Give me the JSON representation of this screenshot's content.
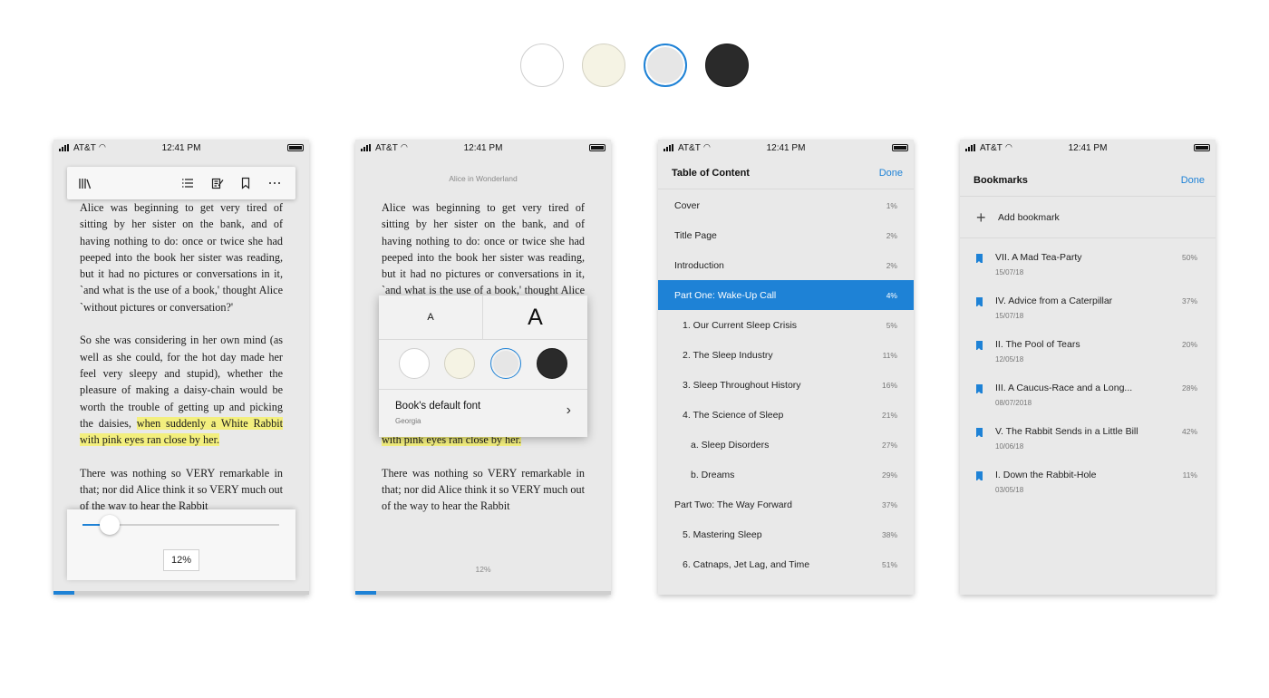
{
  "status_bar": {
    "carrier": "AT&T",
    "time": "12:41 PM"
  },
  "colors": {
    "accent": "#1e82d6",
    "highlight": "#f3ef7e",
    "theme_white": "#ffffff",
    "theme_sepia": "#f5f3e4",
    "theme_gray": "#e6e6e6",
    "theme_dark": "#2a2a2a"
  },
  "icons": {
    "library": "library-icon",
    "contents": "list-icon",
    "notes": "notes-icon",
    "bookmark": "bookmark-icon",
    "more": "more-icon",
    "chevron": "chevron-right-icon",
    "add": "plus-icon"
  },
  "book": {
    "title": "Alice in Wonderland",
    "paragraph_1": "Alice was beginning to get very tired of sitting by her sister on the bank, and of having nothing to do: once or twice she had peeped into the book her sister was reading, but it had no pictures or conversations in it, `and what is the use of a book,' thought Alice `without pictures or conversation?'",
    "paragraph_2_plain": "So she was considering in her own mind (as well as she could, for the hot day made her feel very sleepy and stupid), whether the pleasure of making a daisy-chain would be worth the trouble of getting up and picking the daisies,",
    "paragraph_2_highlight": "when suddenly a White Rabbit with pink eyes ran close by her.",
    "paragraph_3": "There was nothing so VERY remarkable in that; nor did Alice think it so VERY much out of the way to hear the Rabbit",
    "progress_label": "12%",
    "progress": 0.08
  },
  "reader": {
    "slider_value": "12%",
    "slider_fraction": 0.14
  },
  "font_popup": {
    "small_label": "A",
    "large_label": "A",
    "font_label": "Book's default font",
    "font_name": "Georgia"
  },
  "toc": {
    "title": "Table of Content",
    "done": "Done",
    "items": [
      {
        "label": "Cover",
        "pct": "1%",
        "level": 0
      },
      {
        "label": "Title Page",
        "pct": "2%",
        "level": 0
      },
      {
        "label": "Introduction",
        "pct": "2%",
        "level": 0
      },
      {
        "label": "Part One: Wake-Up Call",
        "pct": "4%",
        "level": 0,
        "active": true
      },
      {
        "label": "1. Our Current Sleep Crisis",
        "pct": "5%",
        "level": 1
      },
      {
        "label": "2. The Sleep Industry",
        "pct": "11%",
        "level": 1
      },
      {
        "label": "3. Sleep Throughout History",
        "pct": "16%",
        "level": 1
      },
      {
        "label": "4. The Science of Sleep",
        "pct": "21%",
        "level": 1
      },
      {
        "label": "a. Sleep Disorders",
        "pct": "27%",
        "level": 2
      },
      {
        "label": "b. Dreams",
        "pct": "29%",
        "level": 2
      },
      {
        "label": "Part Two: The Way Forward",
        "pct": "37%",
        "level": 0
      },
      {
        "label": "5. Mastering Sleep",
        "pct": "38%",
        "level": 1
      },
      {
        "label": "6. Catnaps, Jet Lag, and Time",
        "pct": "51%",
        "level": 1
      }
    ]
  },
  "bookmarks": {
    "title": "Bookmarks",
    "done": "Done",
    "add_label": "Add bookmark",
    "items": [
      {
        "title": "VII. A Mad Tea-Party",
        "date": "15/07/18",
        "pct": "50%"
      },
      {
        "title": "IV. Advice from a Caterpillar",
        "date": "15/07/18",
        "pct": "37%"
      },
      {
        "title": "II. The Pool of Tears",
        "date": "12/05/18",
        "pct": "20%"
      },
      {
        "title": "III. A Caucus-Race and a Long...",
        "date": "08/07/2018",
        "pct": "28%"
      },
      {
        "title": "V. The Rabbit Sends in a Little Bill",
        "date": "10/06/18",
        "pct": "42%"
      },
      {
        "title": "I. Down the Rabbit-Hole",
        "date": "03/05/18",
        "pct": "11%"
      }
    ]
  }
}
